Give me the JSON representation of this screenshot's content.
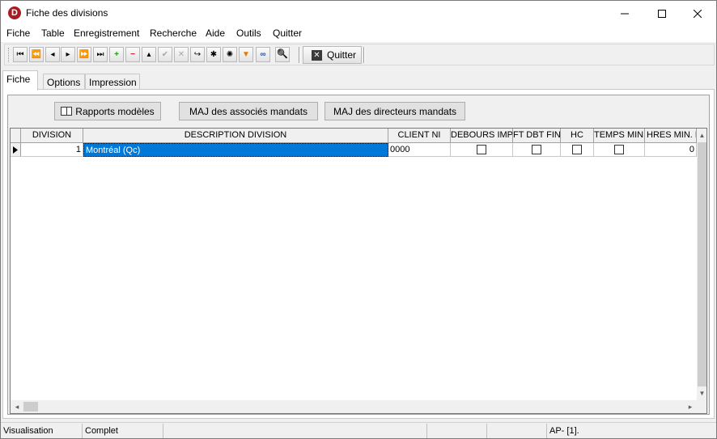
{
  "window": {
    "title": "Fiche des divisions",
    "icon_letter": "D",
    "icon_color": "#a51d22"
  },
  "menu": {
    "items": [
      "Fiche",
      "Table",
      "Enregistrement",
      "Recherche",
      "Aide",
      "Outils",
      "Quitter"
    ]
  },
  "toolbar": {
    "nav_buttons": [
      {
        "name": "first-record",
        "glyph": "⏮"
      },
      {
        "name": "prev-page",
        "glyph": "⏪"
      },
      {
        "name": "prev-record",
        "glyph": "◂"
      },
      {
        "name": "next-record",
        "glyph": "▸"
      },
      {
        "name": "next-page",
        "glyph": "⏩"
      },
      {
        "name": "last-record",
        "glyph": "⏭"
      },
      {
        "name": "add-record",
        "glyph": "+",
        "color": "#1a9c1a"
      },
      {
        "name": "delete-record",
        "glyph": "−",
        "color": "#d01919"
      },
      {
        "name": "edit-record",
        "glyph": "▴"
      },
      {
        "name": "post-record",
        "glyph": "✔",
        "disabled": true
      },
      {
        "name": "cancel-record",
        "glyph": "✕",
        "disabled": true
      },
      {
        "name": "refresh",
        "glyph": "↪"
      },
      {
        "name": "asterisk",
        "glyph": "✱"
      },
      {
        "name": "asterisk-alt",
        "glyph": "✺"
      },
      {
        "name": "filter",
        "glyph": "▼",
        "color": "#e07b00"
      },
      {
        "name": "binoculars",
        "glyph": "∞",
        "color": "#1f4fa8"
      },
      {
        "name": "search",
        "glyph": "🔍"
      }
    ],
    "quit_label": "Quitter"
  },
  "tabs": [
    {
      "label": "Fiche",
      "active": true
    },
    {
      "label": "Options",
      "active": false
    },
    {
      "label": "Impression",
      "active": false
    }
  ],
  "actions": {
    "rapports_label": "Rapports modèles",
    "maj_associes_label": "MAJ des associés mandats",
    "maj_directeurs_label": "MAJ des directeurs mandats"
  },
  "grid": {
    "columns": [
      "DIVISION",
      "DESCRIPTION DIVISION",
      "CLIENT NI",
      "DEBOURS IMP.",
      "FT DBT FIN",
      "HC",
      "TEMPS MIN.",
      "HRES MIN. PL"
    ],
    "rows": [
      {
        "division": "1",
        "description": "Montréal (Qc)",
        "client_ni": "0000",
        "debours_imp": false,
        "ft_dbt_fin": false,
        "hc": false,
        "temps_min": false,
        "hres_min": "0"
      }
    ]
  },
  "status": {
    "mode": "Visualisation",
    "state": "Complet",
    "info": "AP- [1]."
  }
}
